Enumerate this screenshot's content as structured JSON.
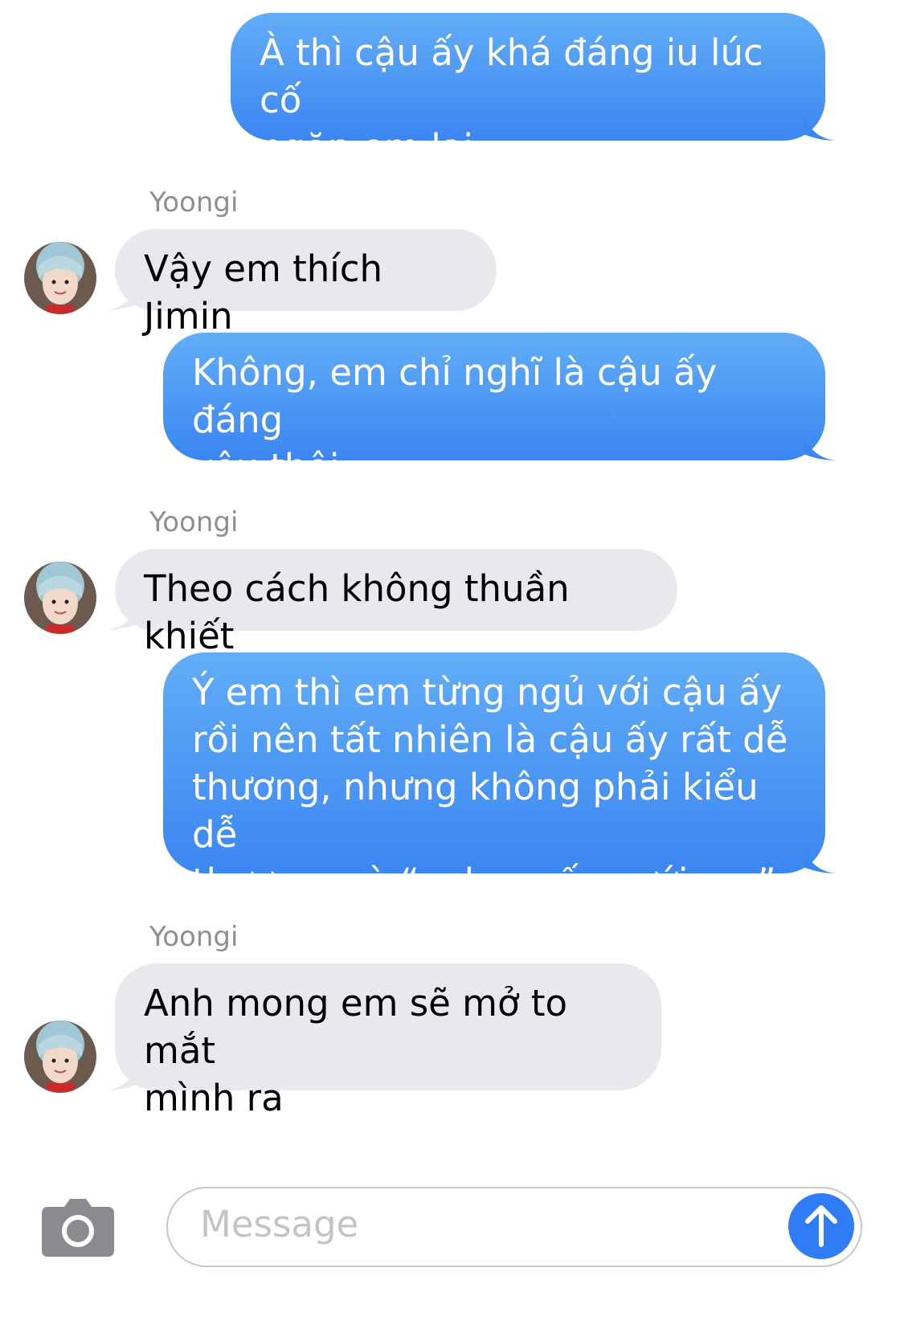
{
  "conversation": {
    "sender_name": "Yoongi",
    "messages": [
      {
        "from": "me",
        "text": "À thì cậu ấy khá đáng iu lúc cố\nngăn em lại"
      },
      {
        "from": "Yoongi",
        "text": "Vậy em thích Jimin"
      },
      {
        "from": "me",
        "text": "Không, em chỉ nghĩ là cậu ấy đáng\nyêu thôi"
      },
      {
        "from": "Yoongi",
        "text": "Theo cách không thuần khiết"
      },
      {
        "from": "me",
        "text": "Ý em thì em từng ngủ với cậu ấy\nrồi nên tất nhiên là cậu ấy rất dễ\nthương, nhưng không phải kiểu dễ\nthương mà “anh muốn cưới em”"
      },
      {
        "from": "Yoongi",
        "text": "Anh mong em sẽ mở to mắt\nmình ra"
      }
    ]
  },
  "composer": {
    "placeholder": "Message",
    "camera_icon": "camera-icon",
    "send_icon": "arrow-up-icon"
  },
  "colors": {
    "outgoing_bubble_top": "#62adf7",
    "outgoing_bubble_bottom": "#3b86f1",
    "incoming_bubble": "#e8e8ed",
    "send_button": "#2f7cf6",
    "sender_label": "#8e8e93"
  }
}
